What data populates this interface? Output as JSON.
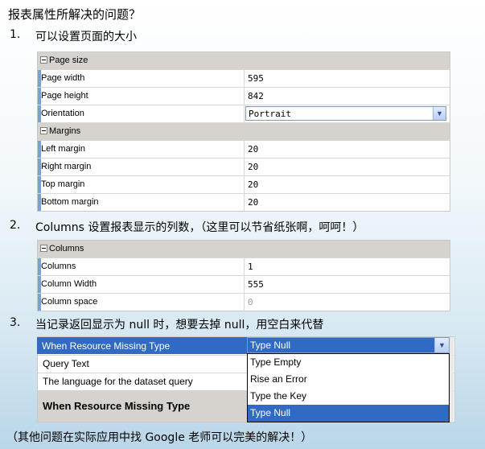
{
  "heading": "报表属性所解决的问题？",
  "item1": {
    "num": "1.",
    "text": "可以设置页面的大小"
  },
  "item2": {
    "num": "2.",
    "text": "Columns 设置报表显示的列数，（这里可以节省纸张啊，呵呵！）"
  },
  "item3": {
    "num": "3.",
    "text": "当记录返回显示为 null 时，想要去掉 null，用空白来代替"
  },
  "footer": "（其他问题在实际应用中找 Google 老师可以完美的解决！）",
  "grid1": {
    "page_size_category": "Page size",
    "page_width_label": "Page width",
    "page_width": "595",
    "page_height_label": "Page height",
    "page_height": "842",
    "orientation_label": "Orientation",
    "orientation": "Portrait",
    "margins_category": "Margins",
    "left_margin_label": "Left margin",
    "left_margin": "20",
    "right_margin_label": "Right margin",
    "right_margin": "20",
    "top_margin_label": "Top margin",
    "top_margin": "20",
    "bottom_margin_label": "Bottom margin",
    "bottom_margin": "20"
  },
  "grid2": {
    "columns_category": "Columns",
    "columns_label": "Columns",
    "columns": "1",
    "column_width_label": "Column Width",
    "column_width": "555",
    "column_space_label": "Column space",
    "column_space": "0"
  },
  "grid3": {
    "missing_type_label": "When Resource Missing Type",
    "missing_type_value": "Type Null",
    "query_text_label": "Query Text",
    "language_label": "The language for the dataset query",
    "description_title": "When Resource Missing Type",
    "options": [
      "Type Empty",
      "Rise an Error",
      "Type the Key",
      "Type Null"
    ]
  },
  "colors": {
    "selection": "#316ac5",
    "category_bg": "#d6d3ce"
  }
}
